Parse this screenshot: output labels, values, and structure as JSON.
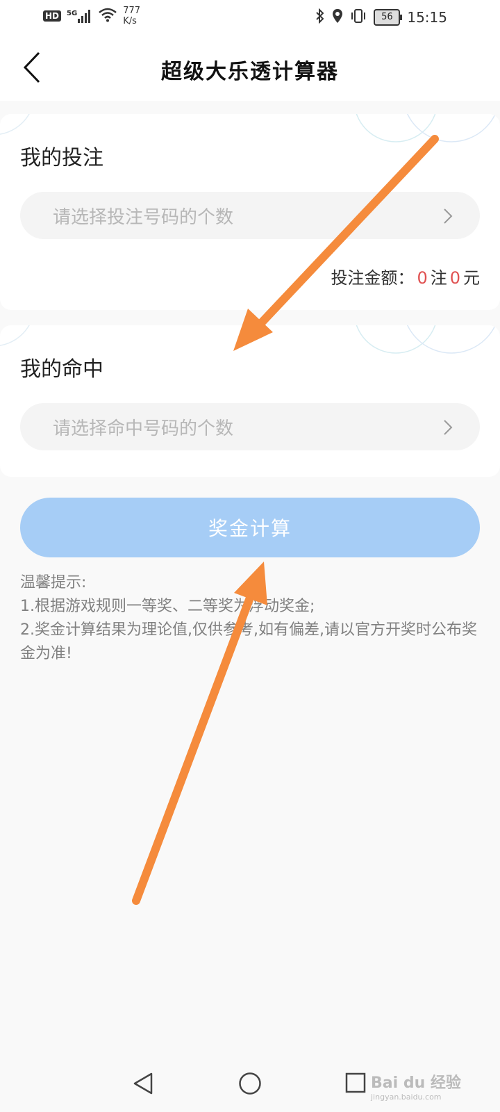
{
  "status_bar": {
    "hd": "HD",
    "network": "5G",
    "speed_value": "777",
    "speed_unit": "K/s",
    "battery": "56",
    "time": "15:15"
  },
  "header": {
    "title": "超级大乐透计算器"
  },
  "bet_card": {
    "title": "我的投注",
    "placeholder": "请选择投注号码的个数",
    "amount_label": "投注金额：",
    "bet_count": "0",
    "bet_unit": "注",
    "amount_value": "0",
    "amount_unit": "元"
  },
  "hit_card": {
    "title": "我的命中",
    "placeholder": "请选择命中号码的个数"
  },
  "calc_button": {
    "label": "奖金计算"
  },
  "tips": {
    "heading": "温馨提示:",
    "line1": "1.根据游戏规则一等奖、二等奖为浮动奖金;",
    "line2": "2.奖金计算结果为理论值,仅供参考,如有偏差,请以官方开奖时公布奖金为准!"
  },
  "watermark": {
    "brand": "Bai du 经验",
    "url": "jingyan.baidu.com"
  },
  "colors": {
    "accent_button": "#a6cdf6",
    "highlight_red": "#e05252",
    "annotation_arrow": "#f58b3c"
  }
}
